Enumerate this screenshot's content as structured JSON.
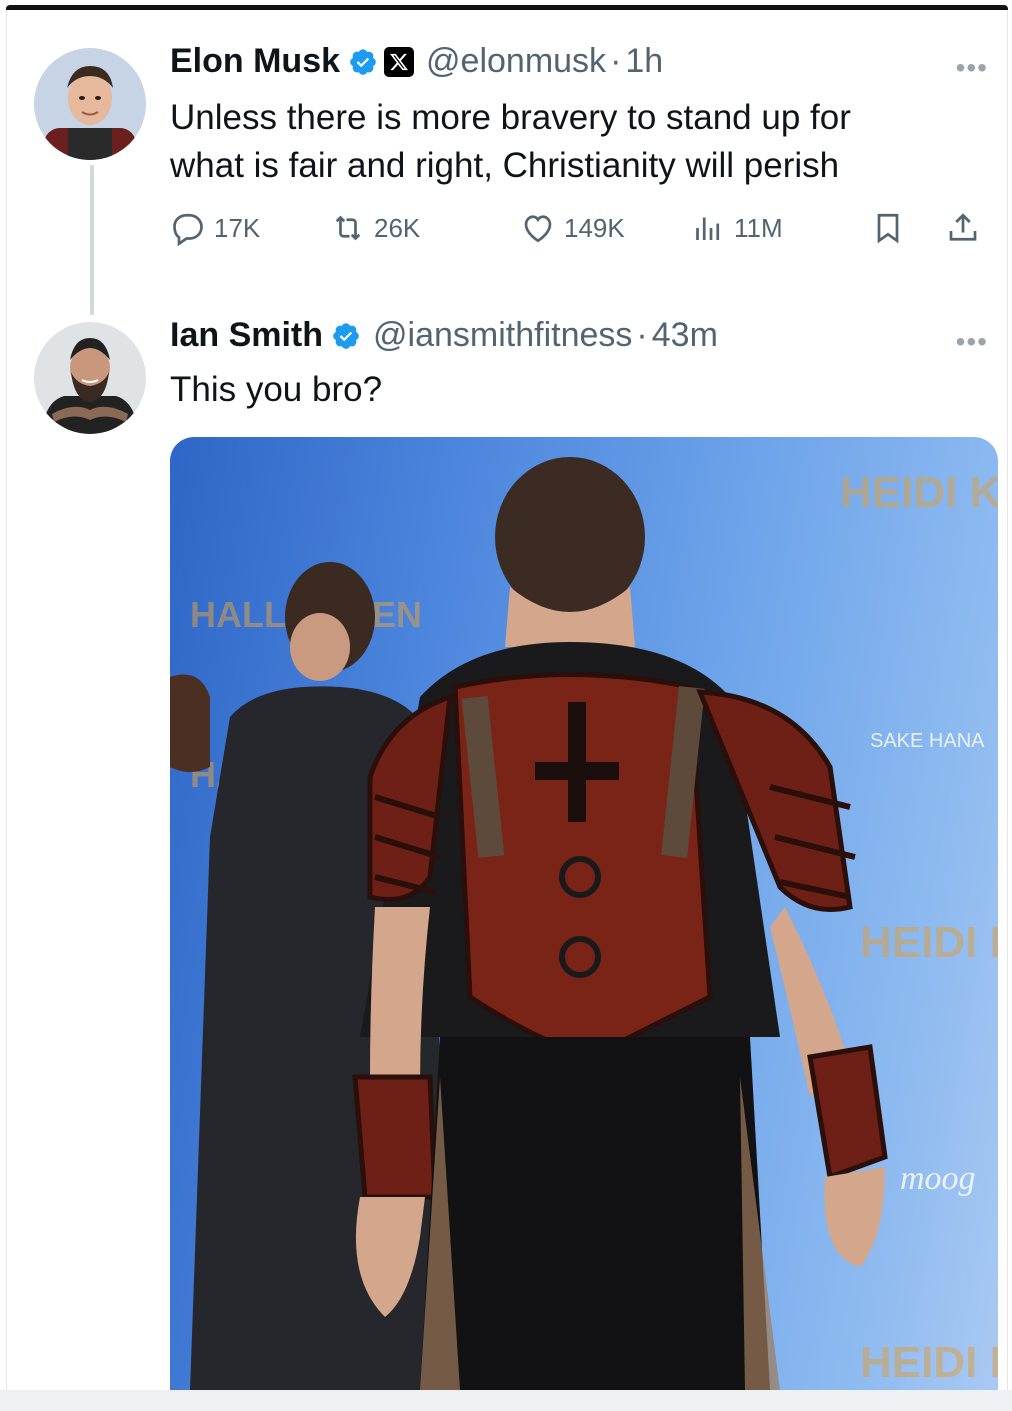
{
  "tweet1": {
    "name": "Elon Musk",
    "handle": "@elonmusk",
    "time": "1h",
    "text_line1": "Unless there is more bravery to stand up for",
    "text_line2": "what is fair and right, Christianity will perish",
    "replies": "17K",
    "reposts": "26K",
    "likes": "149K",
    "views": "11M",
    "verified": true,
    "affiliate_badge": "x-logo-icon"
  },
  "tweet2": {
    "name": "Ian Smith",
    "handle": "@iansmithfitness",
    "time": "43m",
    "text": "This you bro?",
    "verified": true
  },
  "separator": "·",
  "more_glyph": "•••",
  "colors": {
    "verified_blue": "#1d9bf0",
    "secondary_text": "#536471",
    "thread_line": "#cfd9de"
  },
  "media": {
    "watermark_text": "SAKE HANA",
    "signature_text": "moog"
  }
}
